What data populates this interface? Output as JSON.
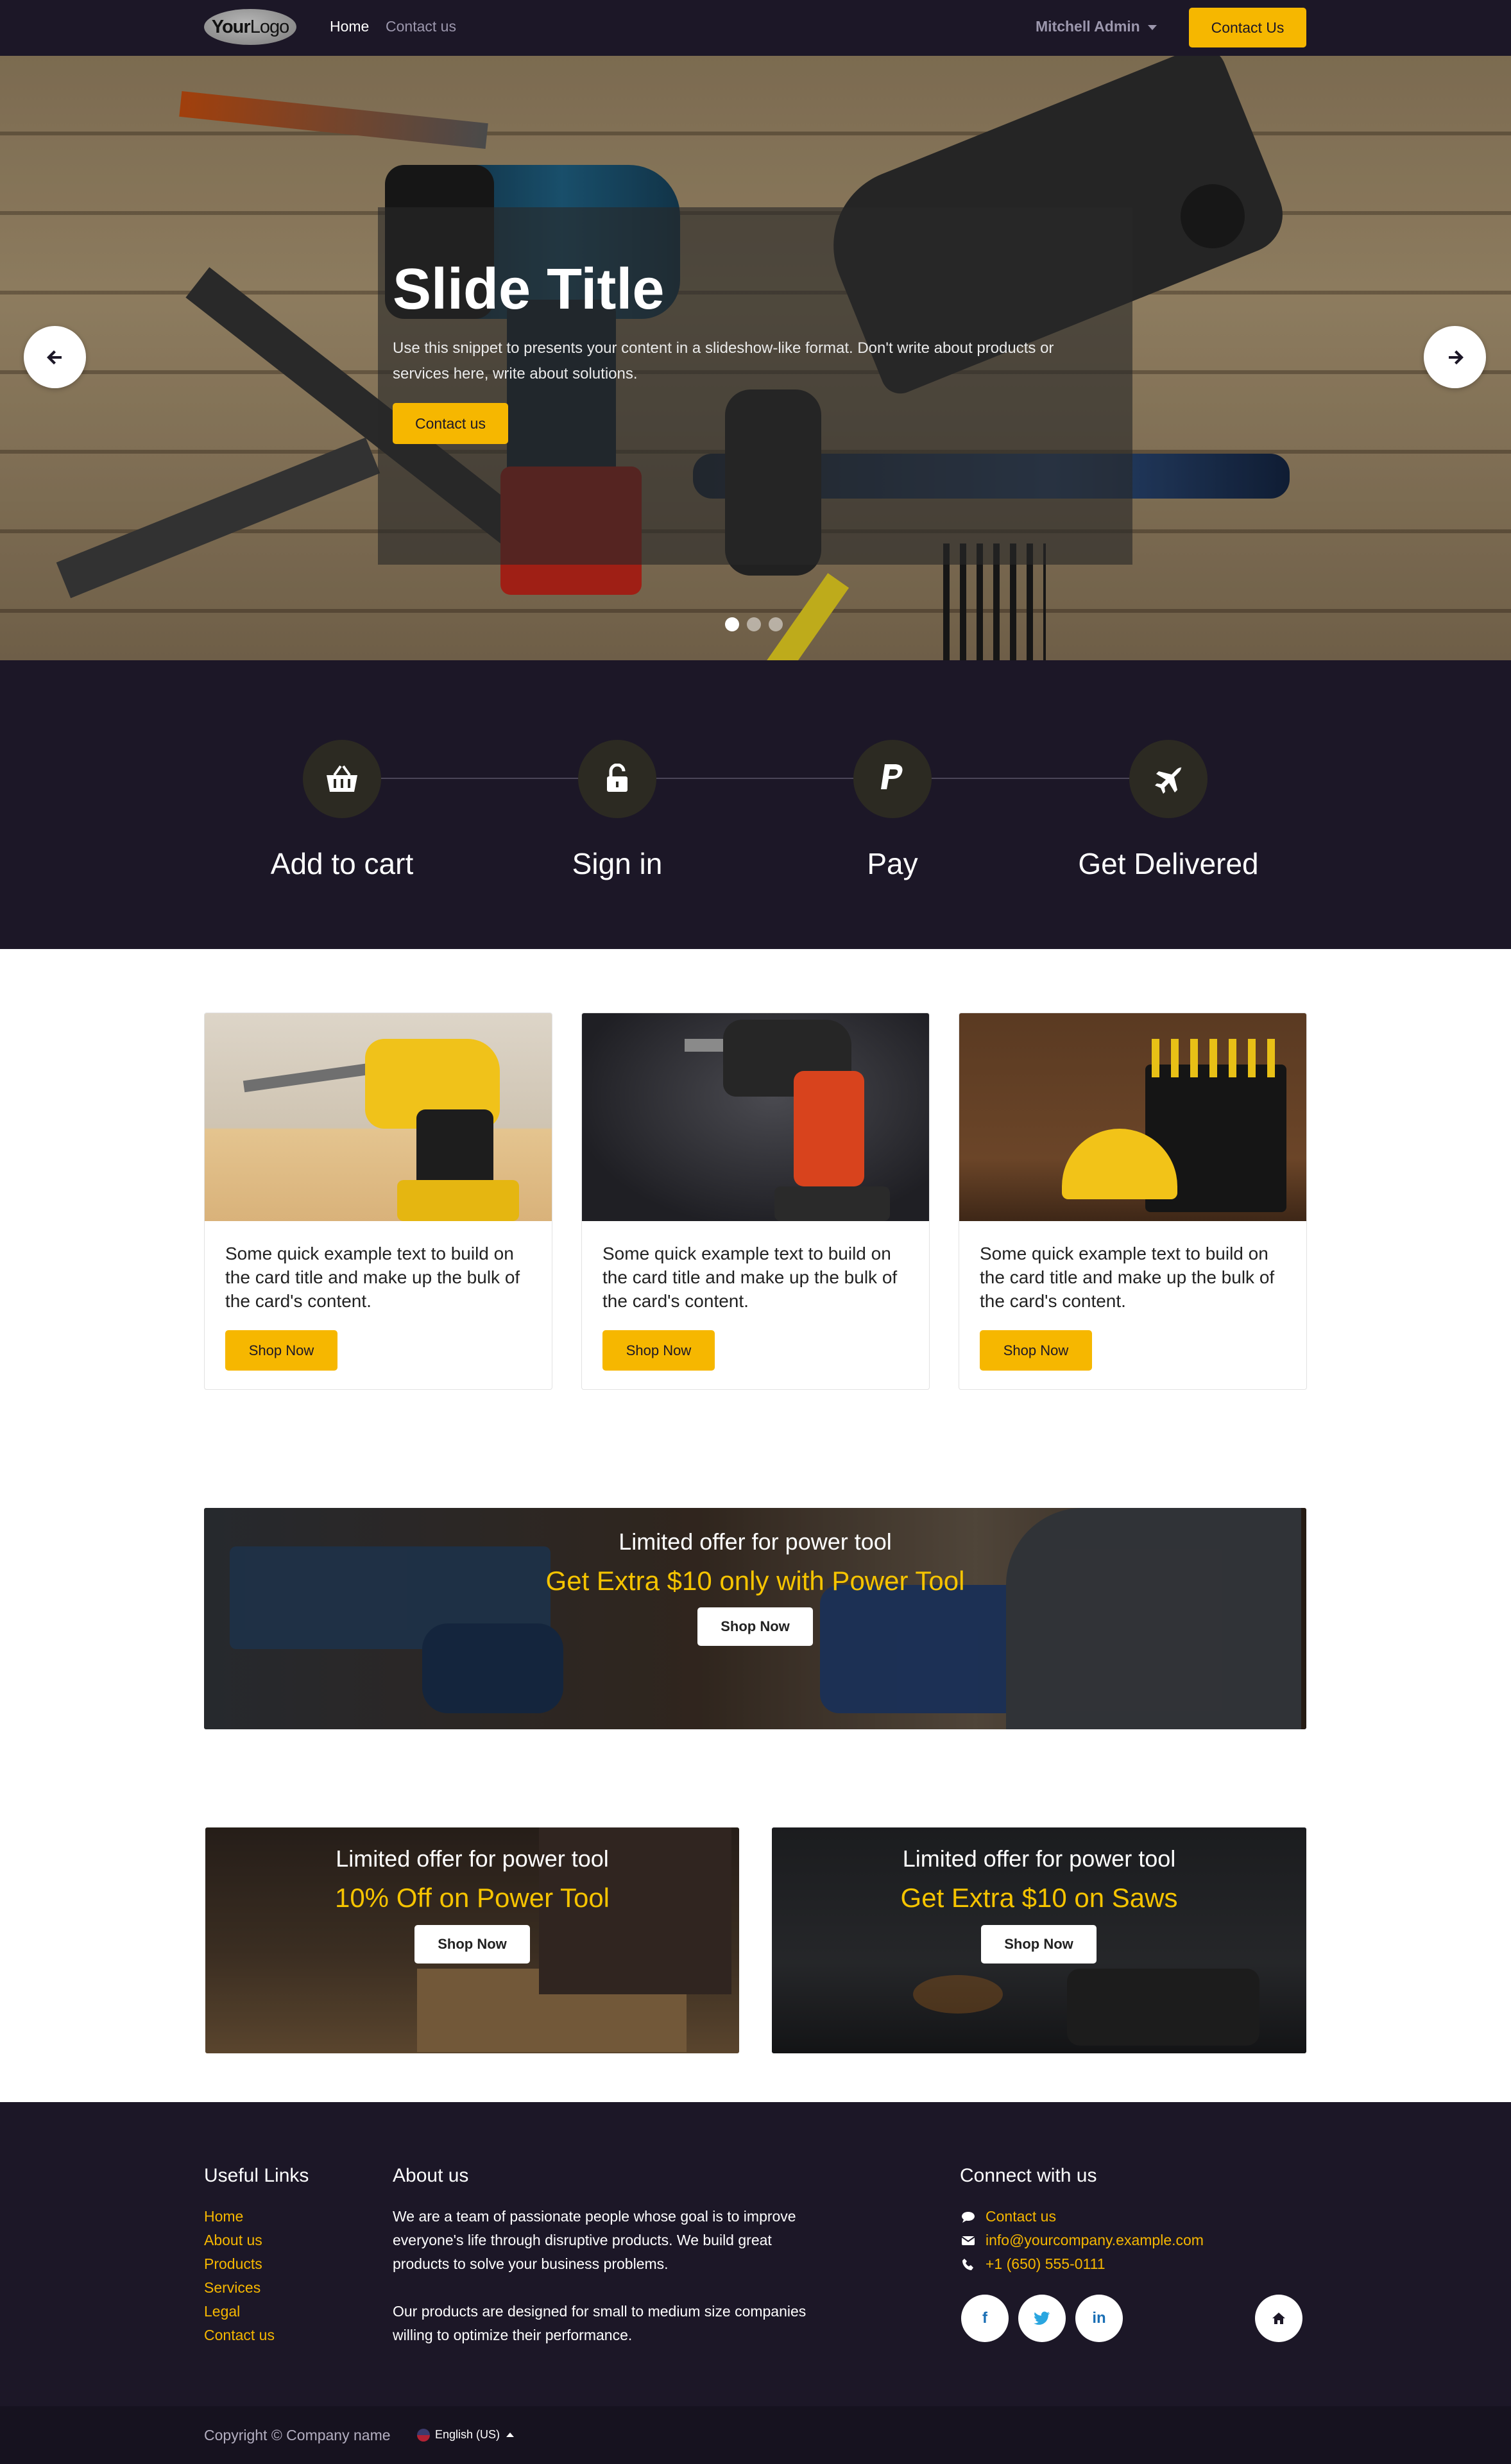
{
  "navbar": {
    "logo_bold": "Your",
    "logo_light": "Logo",
    "links": [
      "Home",
      "Contact us"
    ],
    "user": "Mitchell Admin",
    "cta": "Contact Us"
  },
  "hero": {
    "title": "Slide Title",
    "text": "Use this snippet to presents your content in a slideshow-like format. Don't write about products or services here, write about solutions.",
    "cta": "Contact us",
    "slide_count": 3,
    "active_slide": 1
  },
  "steps": [
    {
      "label": "Add to cart",
      "icon": "basket-icon"
    },
    {
      "label": "Sign in",
      "icon": "unlock-icon"
    },
    {
      "label": "Pay",
      "icon": "paypal-icon"
    },
    {
      "label": "Get Delivered",
      "icon": "plane-icon"
    }
  ],
  "cards": [
    {
      "text": "Some quick example text to build on the card title and make up the bulk of the card's content.",
      "button": "Shop Now"
    },
    {
      "text": "Some quick example text to build on the card title and make up the bulk of the card's content.",
      "button": "Shop Now"
    },
    {
      "text": "Some quick example text to build on the card title and make up the bulk of the card's content.",
      "button": "Shop Now"
    }
  ],
  "promo_wide": {
    "subtitle": "Limited offer for power tool",
    "title": "Get Extra $10 only with Power Tool",
    "button": "Shop Now"
  },
  "promo_left": {
    "subtitle": "Limited offer for power tool",
    "title": "10% Off on Power Tool",
    "button": "Shop Now"
  },
  "promo_right": {
    "subtitle": "Limited offer for power tool",
    "title": "Get Extra $10 on Saws",
    "button": "Shop Now"
  },
  "footer": {
    "useful_links_heading": "Useful Links",
    "useful_links": [
      "Home",
      "About us",
      "Products",
      "Services",
      "Legal",
      "Contact us"
    ],
    "about_heading": "About us",
    "about_p1": "We are a team of passionate people whose goal is to improve everyone's life through disruptive products. We build great products to solve your business problems.",
    "about_p2": "Our products are designed for small to medium size companies willing to optimize their performance.",
    "connect_heading": "Connect with us",
    "contact_label": "Contact us",
    "email": "info@yourcompany.example.com",
    "phone": "+1 (650) 555-0111",
    "social": [
      "facebook-icon",
      "twitter-icon",
      "linkedin-icon",
      "home-icon"
    ]
  },
  "bottom": {
    "copyright": "Copyright © Company name",
    "language": "English (US)"
  },
  "colors": {
    "dark": "#1c1727",
    "accent": "#f6b700",
    "promo_title": "#f6c400"
  }
}
